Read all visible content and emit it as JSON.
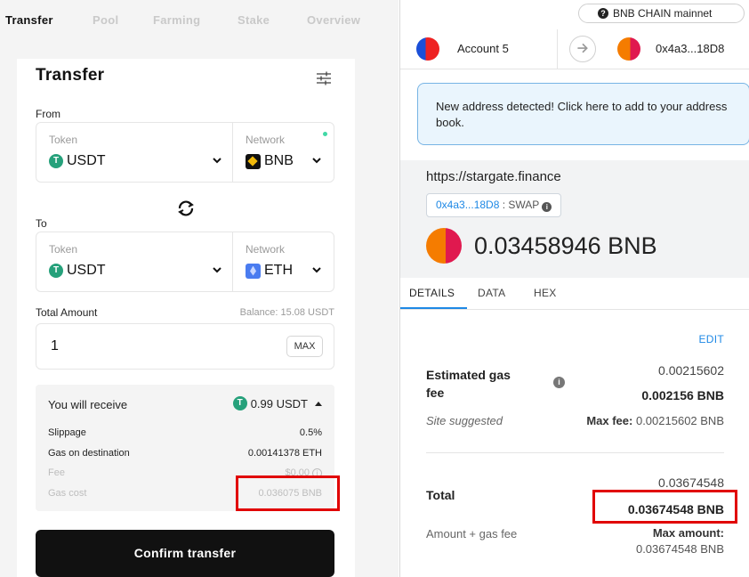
{
  "stargate": {
    "nav": [
      "Transfer",
      "Pool",
      "Farming",
      "Stake",
      "Overview"
    ],
    "title": "Transfer",
    "from_label": "From",
    "to_label": "To",
    "from": {
      "token_label": "Token",
      "token": "USDT",
      "network_label": "Network",
      "network": "BNB"
    },
    "to": {
      "token_label": "Token",
      "token": "USDT",
      "network_label": "Network",
      "network": "ETH"
    },
    "total_amount_label": "Total Amount",
    "balance": "Balance: 15.08 USDT",
    "amount": "1",
    "max_label": "MAX",
    "receive_label": "You will receive",
    "receive_value": "0.99 USDT",
    "rows": [
      {
        "k": "Slippage",
        "v": "0.5%"
      },
      {
        "k": "Gas on destination",
        "v": "0.00141378 ETH"
      },
      {
        "k": "Fee",
        "v": "$0.00"
      },
      {
        "k": "Gas cost",
        "v": "0.036075 BNB"
      }
    ],
    "confirm_label": "Confirm transfer"
  },
  "metamask": {
    "network": "BNB CHAIN mainnet",
    "account": "Account 5",
    "to_address": "0x4a3...18D8",
    "notice": "New address detected! Click here to add to your address book.",
    "origin": "https://stargate.finance",
    "contract_address": "0x4a3...18D8",
    "contract_method": ": SWAP",
    "amount": "0.03458946 BNB",
    "tabs": [
      "DETAILS",
      "DATA",
      "HEX"
    ],
    "edit_label": "EDIT",
    "gas_label": "Estimated gas fee",
    "gas_value": "0.00215602",
    "gas_value_bold": "0.002156 BNB",
    "site_suggested": "Site suggested",
    "max_fee_label": "Max fee:",
    "max_fee_value": "0.00215602 BNB",
    "total_label": "Total",
    "total_value": "0.03674548",
    "total_value_bold": "0.03674548 BNB",
    "amount_gas_label": "Amount + gas fee",
    "max_amount_label": "Max amount:",
    "max_amount_value": "0.03674548 BNB"
  },
  "colors": {
    "highlight": "#e10000",
    "link": "#1e88e5",
    "usdt": "#26a17b",
    "bnb": "#f0b90b"
  }
}
